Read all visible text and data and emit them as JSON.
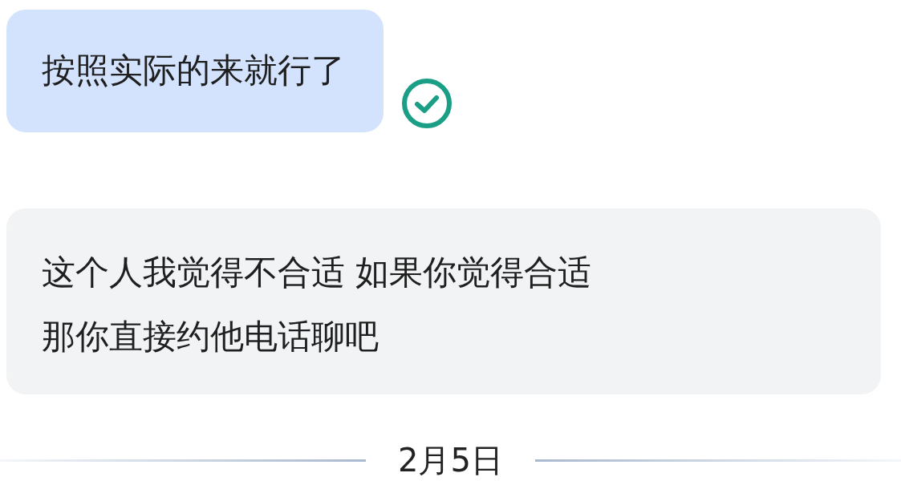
{
  "messages": [
    {
      "kind": "sent",
      "text": "按照实际的来就行了",
      "read": true
    },
    {
      "kind": "received",
      "text": "这个人我觉得不合适 如果你觉得合适那你直接约他电话聊吧"
    }
  ],
  "date_divider": {
    "label": "2月5日"
  }
}
